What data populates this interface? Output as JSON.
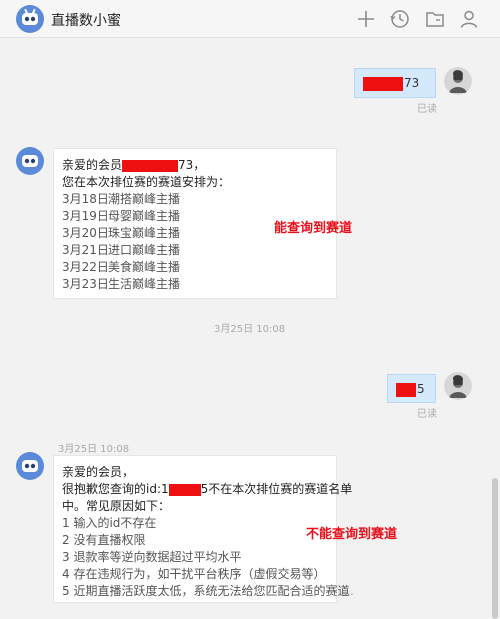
{
  "header": {
    "title": "直播数小蜜",
    "icons": [
      "plus-icon",
      "history-icon",
      "folder-icon",
      "user-icon"
    ]
  },
  "messages": {
    "m1": {
      "visible_tail": "73",
      "status": "已读"
    },
    "m2": {
      "greeting_prefix": "亲爱的会员",
      "greeting_suffix": "73，",
      "intro": "您在本次排位赛的赛道安排为：",
      "schedule": [
        {
          "date": "3月18日",
          "event": "潮搭巅峰主播"
        },
        {
          "date": "3月19日",
          "event": "母婴巅峰主播"
        },
        {
          "date": "3月20日",
          "event": "珠宝巅峰主播"
        },
        {
          "date": "3月21日",
          "event": "进口巅峰主播"
        },
        {
          "date": "3月22日",
          "event": "美食巅峰主播"
        },
        {
          "date": "3月23日",
          "event": "生活巅峰主播"
        }
      ]
    },
    "time1": "3月25日 10:08",
    "m3": {
      "visible_tail": "5",
      "status": "已读"
    },
    "time2": "3月25日 10:08",
    "m4": {
      "greeting": "亲爱的会员，",
      "line1_prefix": "很抱歉您查询的id:1",
      "line1_suffix": "5不在本次排位赛的赛道名单",
      "line2": "中。常见原因如下：",
      "reasons": [
        "1 输入的id不存在",
        "2 没有直播权限",
        "3 退款率等逆向数据超过平均水平",
        "4 存在违规行为，如干扰平台秩序（虚假交易等）",
        "5 近期直播活跃度太低，系统无法给您匹配合适的赛道"
      ]
    }
  },
  "annotations": {
    "found": "能查询到赛道",
    "not_found": "不能查询到赛道"
  },
  "more": "···",
  "colors": {
    "highlight": "#e8101a",
    "redaction": "#ee1010",
    "outgoing_bubble": "#d4e9fb"
  }
}
